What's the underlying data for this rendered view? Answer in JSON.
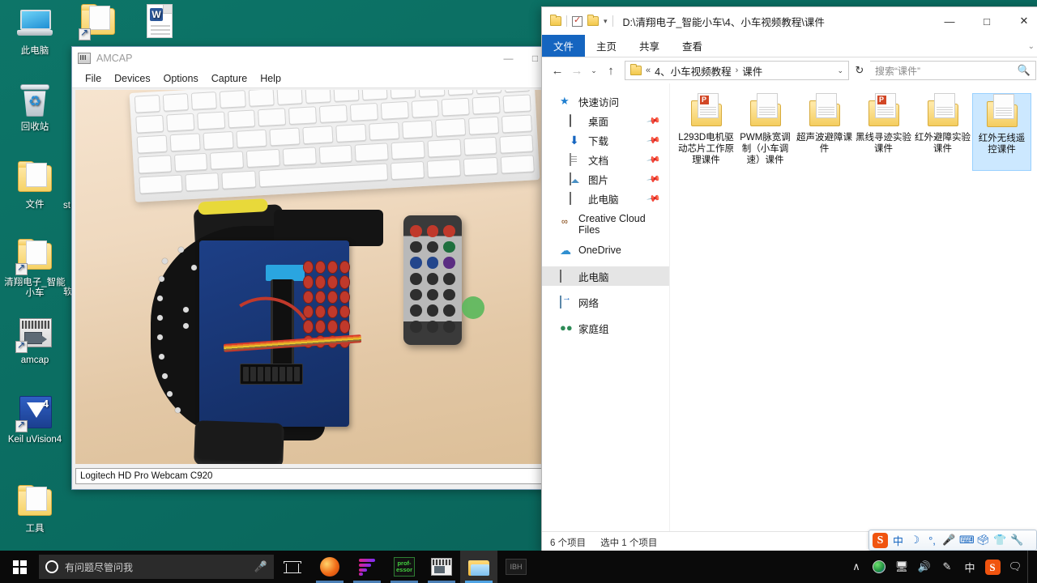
{
  "desktop": {
    "icons": [
      {
        "label": "此电脑",
        "icon": "this-pc-icon"
      },
      {
        "label": "回收站",
        "icon": "recycle-bin-icon"
      },
      {
        "label": "文件",
        "icon": "folder-icon"
      },
      {
        "label": "清翔电子_智能小车",
        "icon": "folder-shortcut-icon"
      },
      {
        "label": "amcap",
        "icon": "amcap-shortcut-icon"
      },
      {
        "label": "Keil uVision4",
        "icon": "keil-icon"
      },
      {
        "label": "工具",
        "icon": "folder-icon"
      },
      {
        "label": "",
        "icon": "folder-shortcut-icon"
      },
      {
        "label": "",
        "icon": "word-document-icon"
      }
    ],
    "partial_labels": {
      "left_a": "st",
      "left_b": "软"
    }
  },
  "amcap": {
    "title": "AMCAP",
    "menu": [
      "File",
      "Devices",
      "Options",
      "Capture",
      "Help"
    ],
    "controls": {
      "minimize": "—",
      "maximize": "□"
    },
    "status": "Logitech HD Pro Webcam C920"
  },
  "explorer": {
    "path": "D:\\清翔电子_智能小车\\4、小车视频教程\\课件",
    "controls": {
      "minimize": "—",
      "maximize": "□",
      "close": "✕"
    },
    "ribbon_tabs": [
      {
        "label": "文件",
        "active": true
      },
      {
        "label": "主页",
        "active": false
      },
      {
        "label": "共享",
        "active": false
      },
      {
        "label": "查看",
        "active": false
      }
    ],
    "ribbon_expander": "⌄",
    "address": {
      "back": "←",
      "forward": "→",
      "history": "⌄",
      "up": "↑",
      "prefix": "«",
      "crumbs": [
        "4、小车视频教程",
        "课件"
      ],
      "crumb_separator": "›",
      "dropdown": "⌄",
      "refresh": "↻"
    },
    "search": {
      "placeholder": "搜索“课件”",
      "icon": "🔍"
    },
    "nav": [
      {
        "label": "快速访问",
        "icon": "star-icon",
        "indent": false,
        "pin": false,
        "selected": false
      },
      {
        "label": "桌面",
        "icon": "desktop-icon",
        "indent": true,
        "pin": true,
        "selected": false
      },
      {
        "label": "下载",
        "icon": "download-icon",
        "indent": true,
        "pin": true,
        "selected": false
      },
      {
        "label": "文档",
        "icon": "documents-icon",
        "indent": true,
        "pin": true,
        "selected": false
      },
      {
        "label": "图片",
        "icon": "pictures-icon",
        "indent": true,
        "pin": true,
        "selected": false
      },
      {
        "label": "此电脑",
        "icon": "this-pc-icon",
        "indent": true,
        "pin": true,
        "selected": false
      },
      {
        "label": "Creative Cloud Files",
        "icon": "creative-cloud-icon",
        "indent": false,
        "pin": false,
        "selected": false
      },
      {
        "label": "OneDrive",
        "icon": "onedrive-icon",
        "indent": false,
        "pin": false,
        "selected": false
      },
      {
        "label": "此电脑",
        "icon": "this-pc-icon",
        "indent": false,
        "pin": false,
        "selected": true
      },
      {
        "label": "网络",
        "icon": "network-icon",
        "indent": false,
        "pin": false,
        "selected": false
      },
      {
        "label": "家庭组",
        "icon": "homegroup-icon",
        "indent": false,
        "pin": false,
        "selected": false
      }
    ],
    "files": [
      {
        "name": "L293D电机驱动芯片工作原理课件",
        "icon": "folder-ppt-icon",
        "selected": false
      },
      {
        "name": "PWM脉宽调制（小车调速）课件",
        "icon": "folder-doc-icon",
        "selected": false
      },
      {
        "name": "超声波避障课件",
        "icon": "folder-doc-icon",
        "selected": false
      },
      {
        "name": "黑线寻迹实验课件",
        "icon": "folder-ppt-icon",
        "selected": false
      },
      {
        "name": "红外避障实验课件",
        "icon": "folder-doc-icon",
        "selected": false
      },
      {
        "name": "红外无线遥控课件",
        "icon": "folder-doc-icon",
        "selected": true
      }
    ],
    "status": {
      "count": "6 个项目",
      "selection": "选中 1 个项目"
    }
  },
  "sogou_toolbar": {
    "logo": "S",
    "items": [
      "中",
      "☽",
      "°,",
      "🎤",
      "⌨",
      "🗳",
      "👕",
      "🔧"
    ]
  },
  "taskbar": {
    "start": "windows-logo",
    "cortana_placeholder": "有问题尽管问我",
    "cortana_mic": "🎤",
    "buttons": [
      {
        "name": "task-view",
        "label": ""
      },
      {
        "name": "firefox",
        "label": ""
      },
      {
        "name": "wifi-app",
        "label": ""
      },
      {
        "name": "professor-app",
        "label": "prof-essor"
      },
      {
        "name": "amcap-app",
        "label": ""
      },
      {
        "name": "file-explorer",
        "label": ""
      },
      {
        "name": "media-app",
        "label": "IBH"
      }
    ],
    "tray": {
      "chevron": "∧",
      "network_globe": "globe-icon",
      "display": "🖥",
      "volume": "🔊",
      "pen": "✒",
      "ime": "中",
      "sogou": "S",
      "action_center": "💬"
    }
  },
  "colors": {
    "desktop_green": "#0b6e63",
    "ribbon_blue": "#1565c0",
    "selection_blue": "#cce8ff",
    "taskbar_black": "#0a0a0a",
    "sogou_orange": "#f0540f"
  }
}
